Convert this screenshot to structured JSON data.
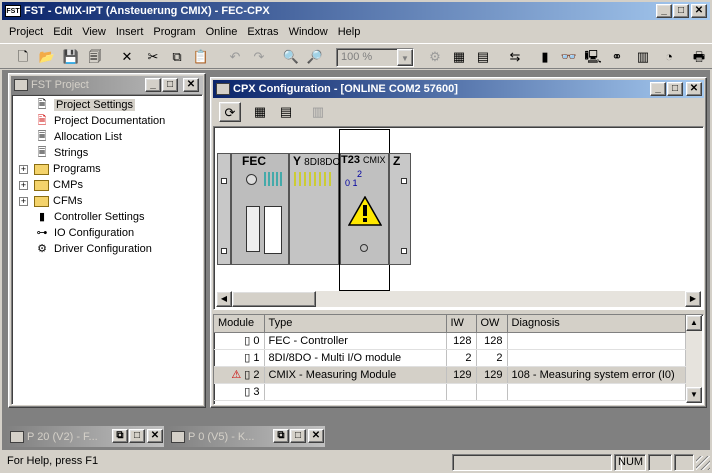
{
  "app": {
    "title": "FST - CMIX-IPT (Ansteuerung CMIX) - FEC-CPX",
    "icon_text": "FST"
  },
  "menu": [
    "Project",
    "Edit",
    "View",
    "Insert",
    "Program",
    "Online",
    "Extras",
    "Window",
    "Help"
  ],
  "toolbar": {
    "zoom_value": "100 %"
  },
  "project_window": {
    "title": "FST Project",
    "items": [
      {
        "label": "Project Settings",
        "icon": "settings-page-icon"
      },
      {
        "label": "Project Documentation",
        "icon": "documentation-icon"
      },
      {
        "label": "Allocation List",
        "icon": "list-icon"
      },
      {
        "label": "Strings",
        "icon": "strings-icon"
      },
      {
        "label": "Programs",
        "icon": "folder-icon"
      },
      {
        "label": "CMPs",
        "icon": "folder-icon"
      },
      {
        "label": "CFMs",
        "icon": "folder-icon"
      },
      {
        "label": "Controller Settings",
        "icon": "controller-icon"
      },
      {
        "label": "IO Configuration",
        "icon": "io-icon"
      },
      {
        "label": "Driver Configuration",
        "icon": "driver-icon"
      }
    ]
  },
  "cpx_window": {
    "title": "CPX Configuration - [ONLINE COM2 57600]",
    "modules": {
      "fec_label": "FEC",
      "y_label": "Y",
      "y_sub": "8DI8DO",
      "t23_label": "T23",
      "cmix_label": "CMIX",
      "z_label": "Z",
      "cmix_top": "2",
      "cmix_bottom": "0 1"
    },
    "table": {
      "headers": [
        "Module",
        "Type",
        "IW",
        "OW",
        "Diagnosis"
      ],
      "rows": [
        {
          "module": "0",
          "type": "FEC - Controller",
          "iw": "128",
          "ow": "128",
          "diagnosis": ""
        },
        {
          "module": "1",
          "type": "8DI/8DO - Multi I/O module",
          "iw": "2",
          "ow": "2",
          "diagnosis": ""
        },
        {
          "module": "2",
          "type": "CMIX - Measuring Module",
          "iw": "129",
          "ow": "129",
          "diagnosis": "108 - Measuring system error (I0)"
        },
        {
          "module": "3",
          "type": "",
          "iw": "",
          "ow": "",
          "diagnosis": ""
        }
      ]
    }
  },
  "minimized": [
    {
      "title": "P 20 (V2) - F..."
    },
    {
      "title": "P  0 (V5) - K..."
    }
  ],
  "status": {
    "text": "For Help, press F1",
    "num": "NUM"
  }
}
